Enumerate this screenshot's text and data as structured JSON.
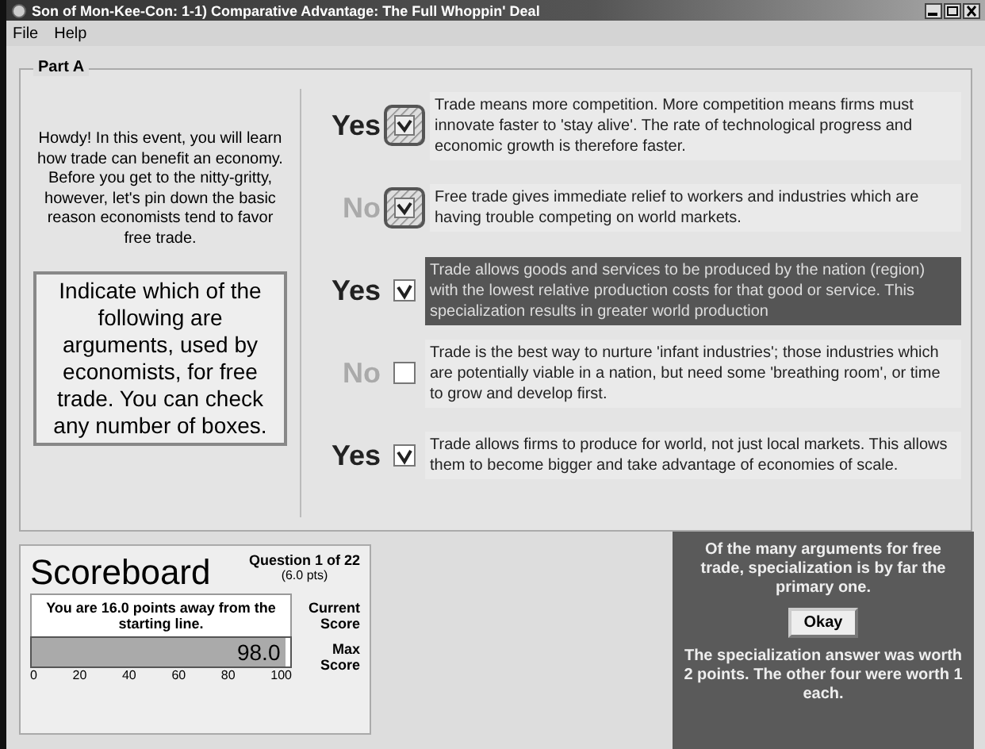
{
  "window": {
    "title": "Son of Mon-Kee-Con:  1-1) Comparative Advantage:  The Full Whoppin' Deal"
  },
  "menu": [
    "File",
    "Help"
  ],
  "part": {
    "title": "Part A",
    "intro": "Howdy!  In this event, you will learn how trade can benefit an economy.  Before you get to the nitty-gritty, however, let's pin down the basic reason economists tend to favor free trade.",
    "instruction": "Indicate which of the following are arguments, used by economists, for free trade.  You can check any number of boxes.",
    "rows": [
      {
        "answer": "Yes",
        "kind": "yes",
        "checked": true,
        "flagged": true,
        "selected": false,
        "text": "Trade means more competition.  More competition means firms must innovate faster to 'stay alive'.  The rate of technological progress and economic growth is therefore faster."
      },
      {
        "answer": "No",
        "kind": "no",
        "checked": true,
        "flagged": true,
        "selected": false,
        "text": "Free trade gives immediate relief to workers and industries which are having trouble competing on world markets."
      },
      {
        "answer": "Yes",
        "kind": "yes",
        "checked": true,
        "flagged": false,
        "selected": true,
        "text": "Trade allows goods and services to be produced by the nation (region) with the lowest relative production costs for that good or service.  This specialization results in greater world production"
      },
      {
        "answer": "No",
        "kind": "no",
        "checked": false,
        "flagged": false,
        "selected": false,
        "text": "Trade is the best way to nurture 'infant industries'; those industries which are potentially viable in a nation, but need some 'breathing room', or time to grow and develop first."
      },
      {
        "answer": "Yes",
        "kind": "yes",
        "checked": true,
        "flagged": false,
        "selected": false,
        "text": "Trade allows firms to produce for world, not just local markets.  This allows them to become bigger and take advantage of economies of scale."
      }
    ]
  },
  "scoreboard": {
    "title": "Scoreboard",
    "question": "Question 1 of 22",
    "points": "(6.0 pts)",
    "message": "You are 16.0 points away from the starting line.",
    "current_label": "Current Score",
    "max_label": "Max Score",
    "score": "98.0",
    "level": 0.98,
    "ticks": [
      "0",
      "20",
      "40",
      "60",
      "80",
      "100"
    ]
  },
  "feedback": {
    "message": "Of the many arguments for free trade, specialization is by far the primary one.",
    "button": "Okay",
    "note": "The specialization answer was worth 2 points.  The other four were worth 1 each."
  }
}
